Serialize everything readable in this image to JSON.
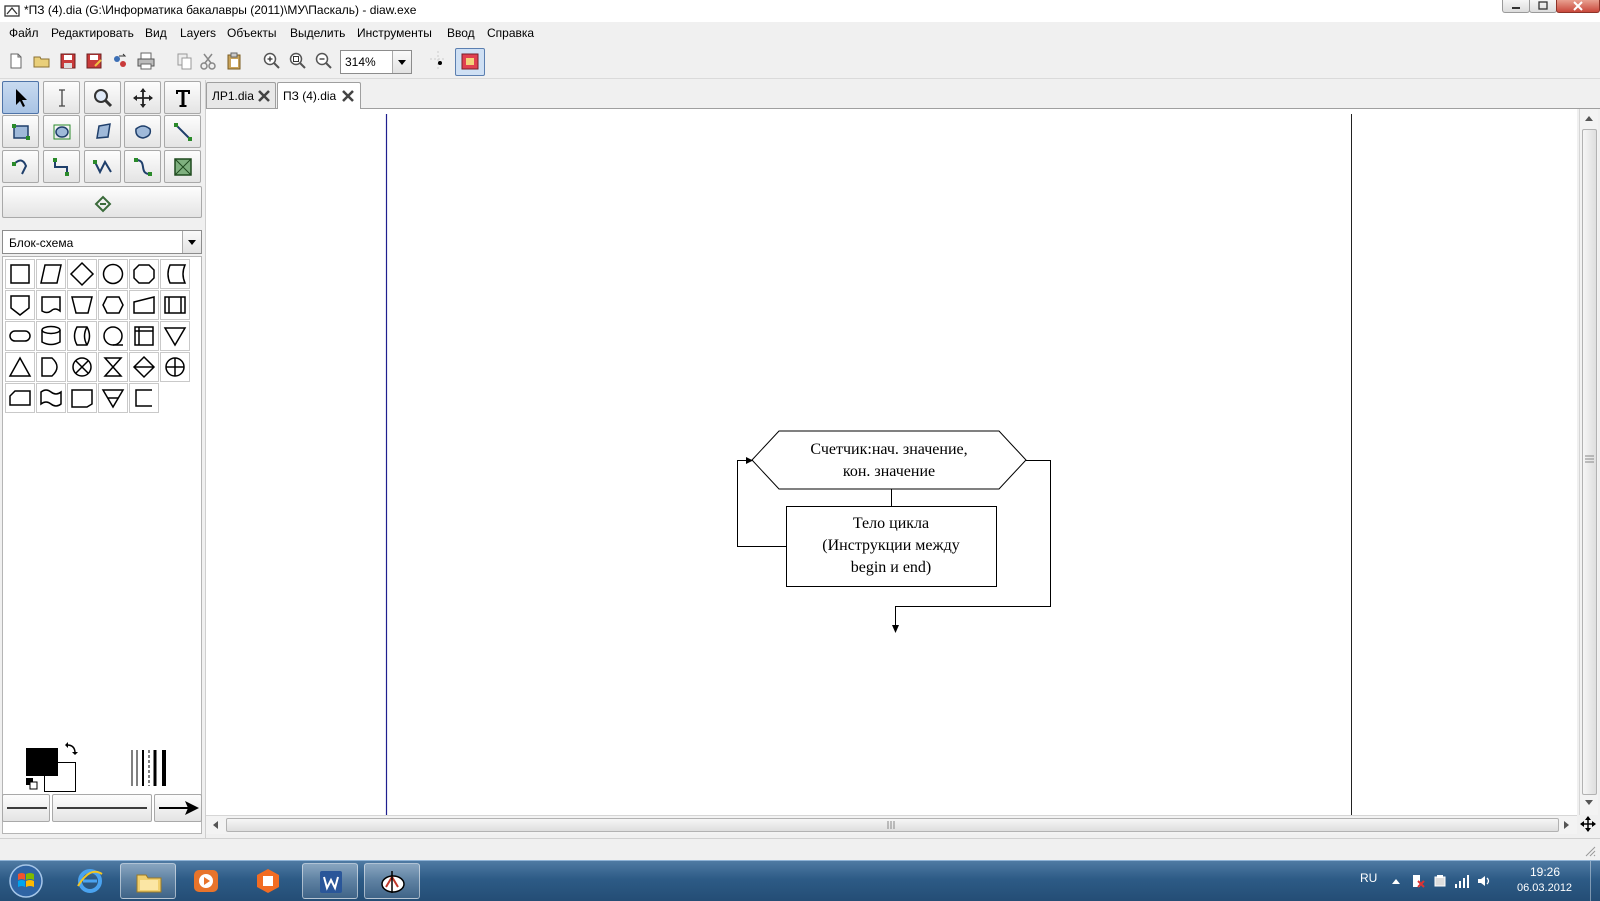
{
  "window": {
    "title": "*ПЗ (4).dia (G:\\Информатика бакалавры (2011)\\МУ\\Паскаль) - diaw.exe"
  },
  "menu": [
    "Файл",
    "Редактировать",
    "Вид",
    "Layers",
    "Объекты",
    "Выделить",
    "Инструменты",
    "Ввод",
    "Справка"
  ],
  "toolbar": {
    "zoom_value": "314%",
    "icons": [
      "new-icon",
      "open-icon",
      "save-icon",
      "save-as-icon",
      "export-icon",
      "print-icon",
      "copy-icon",
      "cut-icon",
      "paste-icon",
      "zoom-in-icon",
      "zoom-fit-icon",
      "zoom-out-icon",
      "snap-grid-icon",
      "snap-object-icon"
    ]
  },
  "toolbox": {
    "sheet": "Блок-схема",
    "tools": [
      "pointer",
      "text-edit",
      "magnify",
      "scroll",
      "text",
      "box",
      "ellipse",
      "polygon",
      "beziergon",
      "line",
      "arc",
      "zigzag-line",
      "polyline",
      "bezier-line",
      "image",
      "outline"
    ],
    "colors": {
      "foreground": "#000000",
      "background": "#ffffff"
    }
  },
  "tabs": [
    {
      "label": "ЛР1.dia",
      "active": false
    },
    {
      "label": "ПЗ (4).dia",
      "active": true
    }
  ],
  "diagram": {
    "preparation_text": [
      "Счетчик:нач. значение,",
      "кон. значение"
    ],
    "process_text": [
      "Тело цикла",
      "(Инструкции между",
      "begin и end)"
    ]
  },
  "taskbar": {
    "language": "RU",
    "time": "19:26",
    "date": "06.03.2012",
    "apps": [
      "ie-icon",
      "explorer-icon",
      "media-player-icon",
      "office-icon",
      "word-icon",
      "dia-icon"
    ]
  }
}
